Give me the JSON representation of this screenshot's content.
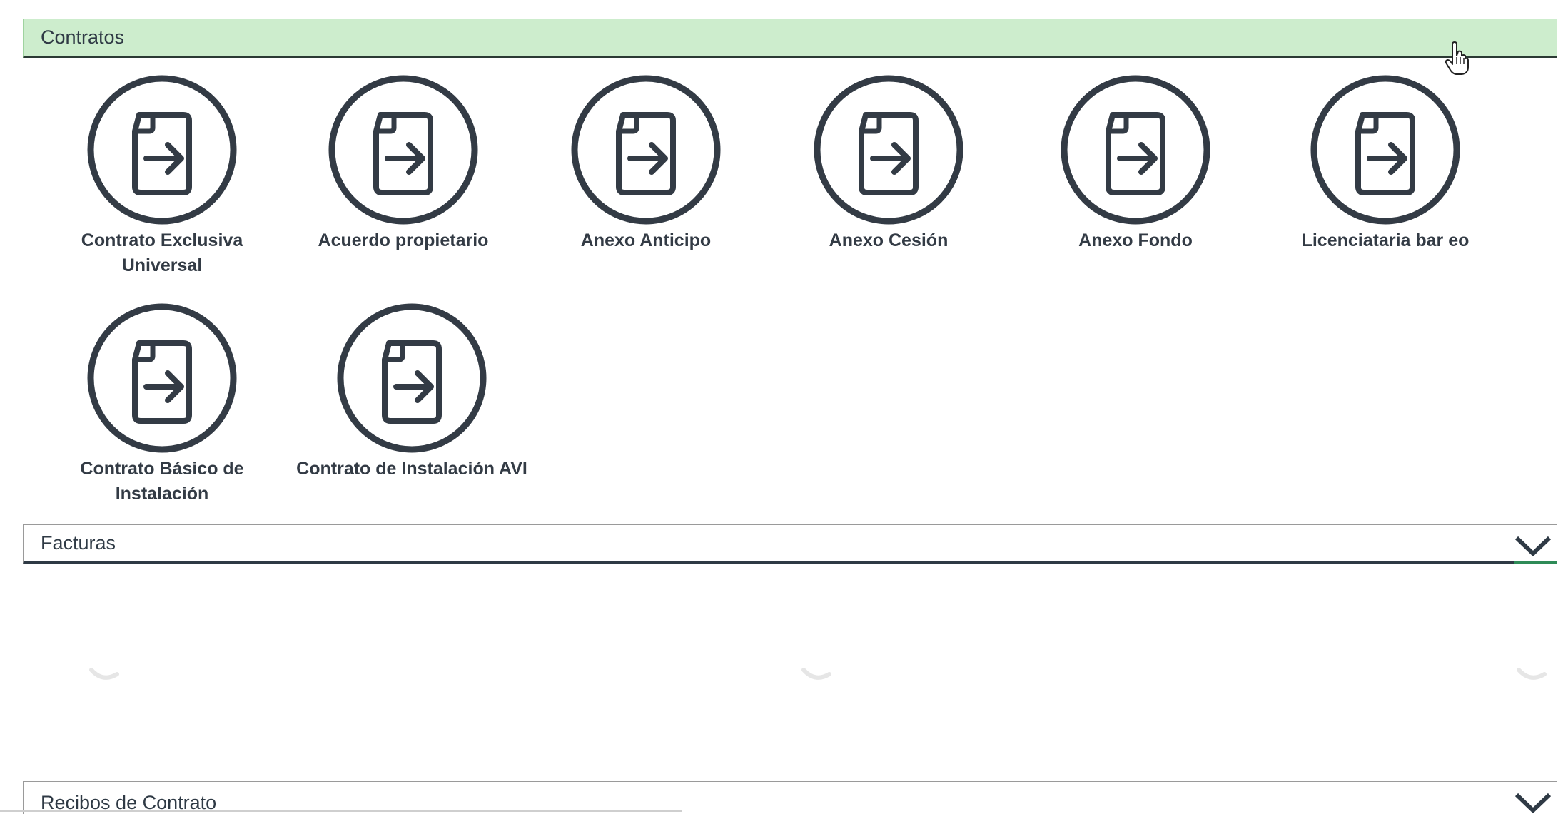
{
  "sections": {
    "contratos": {
      "title": "Contratos",
      "tiles": [
        {
          "label": "Contrato Exclusiva Universal",
          "icon": "file-arrow-icon"
        },
        {
          "label": "Acuerdo propietario",
          "icon": "file-arrow-icon"
        },
        {
          "label": "Anexo Anticipo",
          "icon": "file-arrow-icon"
        },
        {
          "label": "Anexo Cesión",
          "icon": "file-arrow-icon"
        },
        {
          "label": "Anexo Fondo",
          "icon": "file-arrow-icon"
        },
        {
          "label": "Licenciataria bar eo",
          "icon": "file-arrow-icon"
        },
        {
          "label": "Contrato Básico de Instalación",
          "icon": "file-arrow-icon"
        },
        {
          "label": "Contrato de Instalación AVI",
          "icon": "file-arrow-icon"
        }
      ]
    },
    "facturas": {
      "title": "Facturas",
      "toggle_icon": "chevron-down-icon"
    },
    "recibos": {
      "title": "Recibos de Contrato",
      "toggle_icon": "chevron-down-icon"
    }
  },
  "colors": {
    "active_header_bg": "#cdedcd",
    "icon_stroke": "#333b45",
    "header_underline": "#2b3a34",
    "accent_green": "#2e8b57"
  }
}
